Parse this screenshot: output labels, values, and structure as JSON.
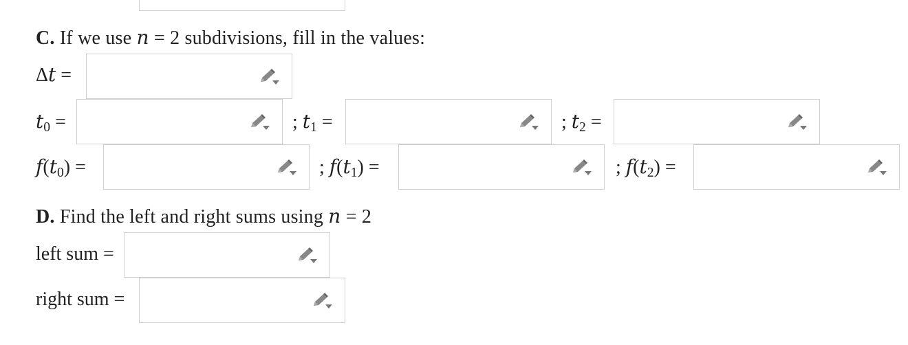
{
  "section_c": {
    "letter": "C.",
    "text_before": "If we use",
    "var_n": "n",
    "equals": "=",
    "n_value": "2",
    "text_after": "subdivisions, fill in the values:"
  },
  "delta_t": {
    "delta": "Δ",
    "var": "t",
    "eq": "="
  },
  "t_values": {
    "t0_var": "t",
    "t0_sub": "0",
    "t0_eq": "=",
    "sep1": ";",
    "t1_var": "t",
    "t1_sub": "1",
    "t1_eq": "=",
    "sep2": ";",
    "t2_var": "t",
    "t2_sub": "2",
    "t2_eq": "="
  },
  "f_values": {
    "f": "f",
    "open": "(",
    "close": ")",
    "t": "t",
    "sub0": "0",
    "sub1": "1",
    "sub2": "2",
    "eq": "=",
    "sep": ";"
  },
  "section_d": {
    "letter": "D.",
    "text": "Find the left and right sums using",
    "var_n": "n",
    "equals": "=",
    "n_value": "2"
  },
  "sums": {
    "left_label": "left sum =",
    "right_label": "right sum ="
  },
  "inputs": {
    "top_partial": "",
    "delta_t": "",
    "t0": "",
    "t1": "",
    "t2": "",
    "f_t0": "",
    "f_t1": "",
    "f_t2": "",
    "left_sum": "",
    "right_sum": ""
  },
  "icons": {
    "edit": "pencil-dropdown-icon"
  }
}
